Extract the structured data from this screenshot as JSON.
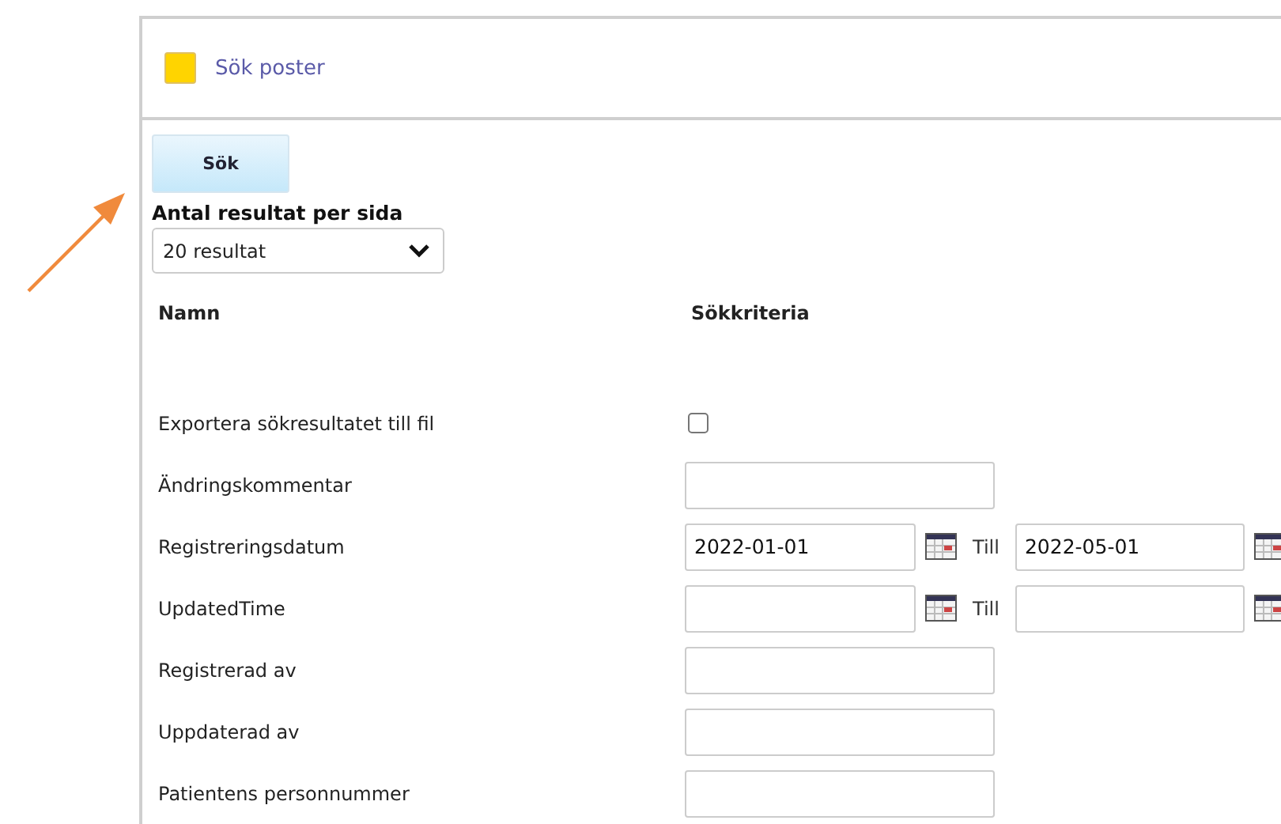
{
  "header": {
    "title": "Sök poster"
  },
  "search_button": "Sök",
  "page_size": {
    "label": "Antal resultat per sida",
    "value": "20 resultat"
  },
  "columns": [
    "Namn",
    "Sökkriteria"
  ],
  "rows": [
    {
      "kind": "checkbox",
      "label": "Exportera sökresultatet till fil",
      "checked": false
    },
    {
      "kind": "text",
      "label": "Ändringskommentar",
      "value": ""
    },
    {
      "kind": "daterange",
      "label": "Registreringsdatum",
      "from": "2022-01-01",
      "separator": "Till",
      "to": "2022-05-01"
    },
    {
      "kind": "daterange",
      "label": "UpdatedTime",
      "from": "",
      "separator": "Till",
      "to": ""
    },
    {
      "kind": "text",
      "label": "Registrerad av",
      "value": ""
    },
    {
      "kind": "text",
      "label": "Uppdaterad av",
      "value": ""
    },
    {
      "kind": "text",
      "label": "Patientens personnummer",
      "value": ""
    }
  ]
}
